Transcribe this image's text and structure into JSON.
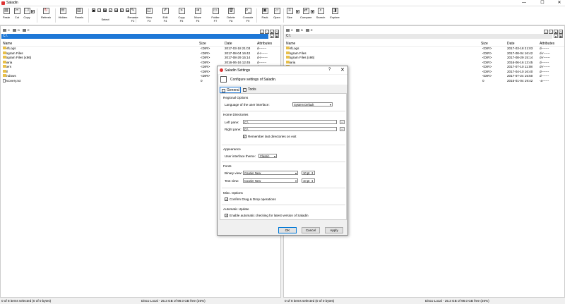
{
  "app": {
    "title": "Saladin"
  },
  "window_controls": {
    "minimize": "—",
    "maximize": "☐",
    "close": "✕"
  },
  "toolbar": {
    "buttons": [
      {
        "label": "Paste",
        "label2": "",
        "icon": "paste-icon",
        "glyph": "▤"
      },
      {
        "label": "Cut",
        "label2": "",
        "icon": "cut-icon",
        "glyph": "✂"
      },
      {
        "label": "Copy",
        "label2": "",
        "icon": "copy-icon",
        "glyph": "❐"
      },
      {
        "label": "Refresh",
        "label2": "",
        "icon": "refresh-icon",
        "glyph": "↻"
      },
      {
        "label": "Hidden",
        "label2": "",
        "icon": "hidden-icon",
        "glyph": "☰"
      },
      {
        "label": "Panels",
        "label2": "",
        "icon": "panels-icon",
        "glyph": "▥"
      },
      {
        "label": "Select",
        "label2": "",
        "icon": "select-icon",
        "glyph": "☑"
      },
      {
        "label": "Rename",
        "label2": "F2",
        "icon": "rename-icon",
        "glyph": "✎"
      },
      {
        "label": "View",
        "label2": "F3",
        "icon": "view-icon",
        "glyph": "◫"
      },
      {
        "label": "Edit",
        "label2": "F4",
        "icon": "edit-icon",
        "glyph": "✐"
      },
      {
        "label": "Copy",
        "label2": "F5",
        "icon": "copy-f5-icon",
        "glyph": "»"
      },
      {
        "label": "Move",
        "label2": "F6",
        "icon": "move-icon",
        "glyph": "➜"
      },
      {
        "label": "Folder",
        "label2": "F7",
        "icon": "new-folder-icon",
        "glyph": "▭"
      },
      {
        "label": "Delete",
        "label2": "F8",
        "icon": "delete-icon",
        "glyph": "🗑"
      },
      {
        "label": "Console",
        "label2": "F9",
        "icon": "console-icon",
        "glyph": ">_"
      },
      {
        "label": "Pack",
        "label2": "",
        "icon": "pack-icon",
        "glyph": "▣"
      },
      {
        "label": "Open",
        "label2": "",
        "icon": "open-icon",
        "glyph": "▱"
      },
      {
        "label": "Size",
        "label2": "",
        "icon": "size-icon",
        "glyph": "≡"
      },
      {
        "label": "Compare",
        "label2": "",
        "icon": "compare-icon",
        "glyph": "⇄"
      },
      {
        "label": "Search",
        "label2": "",
        "icon": "search-icon",
        "glyph": "⌕"
      },
      {
        "label": "Explore",
        "label2": "",
        "icon": "explore-icon",
        "glyph": "◨"
      }
    ]
  },
  "left_panel": {
    "drives": [
      {
        "label": "C"
      },
      {
        "label": "D"
      },
      {
        "label": "E"
      }
    ],
    "path": "C:\\",
    "columns": {
      "name": "Name",
      "size": "Size",
      "date": "Date",
      "attributes": "Attributes"
    },
    "rows": [
      {
        "name": "PerfLogs",
        "size": "<DIR>",
        "date": "2017-03-18 21:03",
        "attr": "d-------"
      },
      {
        "name": "Program Files",
        "size": "<DIR>",
        "date": "2017-08-04 16:42",
        "attr": "d-r------"
      },
      {
        "name": "Program Files (x86)",
        "size": "<DIR>",
        "date": "2017-08-29 15:14",
        "attr": "d-r------"
      },
      {
        "name": "Sharia",
        "size": "<DIR>",
        "date": "2016-06-16 12:45",
        "attr": "d-------"
      },
      {
        "name": "Users",
        "size": "<DIR>",
        "date": "2017-07-10 11:08",
        "attr": "d-r------"
      },
      {
        "name": "Util",
        "size": "<DIR>",
        "date": "2017-04-10 16:40",
        "attr": "d-------"
      },
      {
        "name": "Windows",
        "size": "<DIR>",
        "date": "2017-07-24 15:50",
        "attr": "d-------"
      },
      {
        "name": "Recovery.txt",
        "size": "0",
        "date": "2016-01-04 19:42",
        "attr": "-a------"
      }
    ],
    "status_left": "0 of 8 items selected (0 of 0 bytes)",
    "status_right": "Disco Local - 25.3 GB of 98.0 GB free (26%)"
  },
  "right_panel": {
    "drives": [
      {
        "label": "C"
      },
      {
        "label": "D"
      },
      {
        "label": "E"
      }
    ],
    "path": "C:\\",
    "columns": {
      "name": "Name",
      "size": "Size",
      "date": "Date",
      "attributes": "Attributes"
    },
    "rows": [
      {
        "name": "PerfLogs",
        "size": "<DIR>",
        "date": "2017-03-18 21:03",
        "attr": "d-------"
      },
      {
        "name": "Program Files",
        "size": "<DIR>",
        "date": "2017-08-04 16:42",
        "attr": "d-r------"
      },
      {
        "name": "Program Files (x86)",
        "size": "<DIR>",
        "date": "2017-08-29 15:14",
        "attr": "d-r------"
      },
      {
        "name": "Sharia",
        "size": "<DIR>",
        "date": "2016-06-16 12:45",
        "attr": "d-------"
      },
      {
        "name": "Users",
        "size": "<DIR>",
        "date": "2017-07-10 11:08",
        "attr": "d-r------"
      },
      {
        "name": "Util",
        "size": "<DIR>",
        "date": "2017-04-10 16:40",
        "attr": "d-------"
      },
      {
        "name": "Windows",
        "size": "<DIR>",
        "date": "2017-07-24 15:50",
        "attr": "d-------"
      },
      {
        "name": "Recovery.txt",
        "size": "0",
        "date": "2016-01-04 19:42",
        "attr": "-a------"
      }
    ],
    "status_left": "0 of 8 items selected (0 of 0 bytes)",
    "status_right": "Disco Local - 25.3 GB of 98.0 GB free (26%)"
  },
  "dialog": {
    "title": "Saladin Settings",
    "help": "?",
    "close": "✕",
    "header": "Configure settings of Saladin.",
    "tabs": [
      {
        "label": "General"
      },
      {
        "label": "Tools"
      }
    ],
    "regional": {
      "title": "Regional Options",
      "language_label": "Language of the user interface:",
      "language_value": "System Default"
    },
    "home": {
      "title": "Home Directories",
      "left_label": "Left pane:",
      "left_value": "C:\\",
      "right_label": "Right pane:",
      "right_value": "D:\\",
      "remember_label": "Remember last directories on exit",
      "remember_checked": "✓",
      "browse": "..."
    },
    "appearance": {
      "title": "Appearance",
      "theme_label": "User interface theme:",
      "theme_value": "Classic"
    },
    "fonts": {
      "title": "Fonts",
      "binary_label": "Binary view:",
      "binary_font": "Courier New",
      "binary_size": "10 pt",
      "text_label": "Text view:",
      "text_font": "Courier New",
      "text_size": "10 pt"
    },
    "misc": {
      "title": "Misc. Options",
      "confirm_label": "Confirm Drag & Drop operations",
      "confirm_checked": "✓"
    },
    "update": {
      "title": "Automatic Update",
      "enable_label": "Enable automatic checking for latest version of Saladin",
      "enable_checked": "✓"
    },
    "buttons": {
      "ok": "OK",
      "cancel": "Cancel",
      "apply": "Apply"
    }
  },
  "colors": {
    "accent": "#1e78d7",
    "folder": "#e8c04a",
    "brand": "#d33333"
  }
}
